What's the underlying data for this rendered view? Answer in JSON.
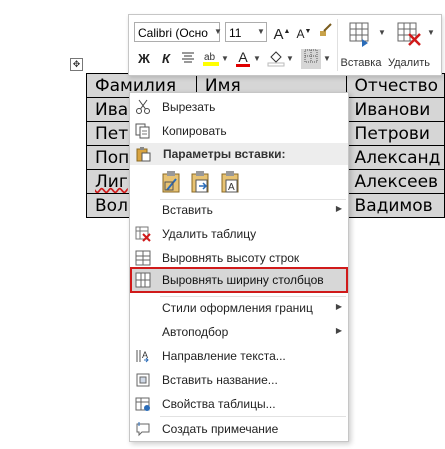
{
  "table": {
    "rows": [
      [
        "Фамилия",
        "Имя",
        "Отчество"
      ],
      [
        "Ива",
        "",
        "Иванови"
      ],
      [
        "Пет",
        "",
        "Петрови"
      ],
      [
        "Поп",
        "",
        "Александ"
      ],
      [
        "Лиг",
        "",
        "Алексеев"
      ],
      [
        "Вол",
        "",
        "Вадимов"
      ]
    ]
  },
  "toolbar": {
    "font_name": "Calibri (Осно",
    "font_size": "11",
    "grow_font": "A",
    "shrink_font": "A",
    "bold": "Ж",
    "italic": "К",
    "font_color": "А",
    "insert_label": "Вставка",
    "delete_label": "Удалить",
    "colors": {
      "highlight": "#ffff00",
      "font": "#e00000",
      "shading": "#ffffff"
    }
  },
  "context_menu": {
    "items": [
      {
        "label": "Вырезать",
        "icon": "scissors-icon"
      },
      {
        "label": "Копировать",
        "icon": "copy-icon"
      },
      {
        "label": "Параметры вставки:",
        "icon": "paste-icon"
      },
      {
        "label": "Вставить",
        "submenu": true
      },
      {
        "label": "Удалить таблицу",
        "icon": "delete-table-icon"
      },
      {
        "label": "Выровнять высоту строк",
        "icon": "distribute-rows-icon"
      },
      {
        "label": "Выровнять ширину столбцов",
        "icon": "distribute-columns-icon",
        "highlighted": true
      },
      {
        "label": "Стили оформления границ",
        "submenu": true
      },
      {
        "label": "Автоподбор",
        "submenu": true
      },
      {
        "label": "Направление текста...",
        "icon": "text-direction-icon"
      },
      {
        "label": "Вставить название...",
        "icon": "insert-caption-icon"
      },
      {
        "label": "Свойства таблицы...",
        "icon": "table-properties-icon"
      },
      {
        "label": "Создать примечание",
        "icon": "new-comment-icon"
      }
    ],
    "highlight_color": "#d01a1a"
  }
}
